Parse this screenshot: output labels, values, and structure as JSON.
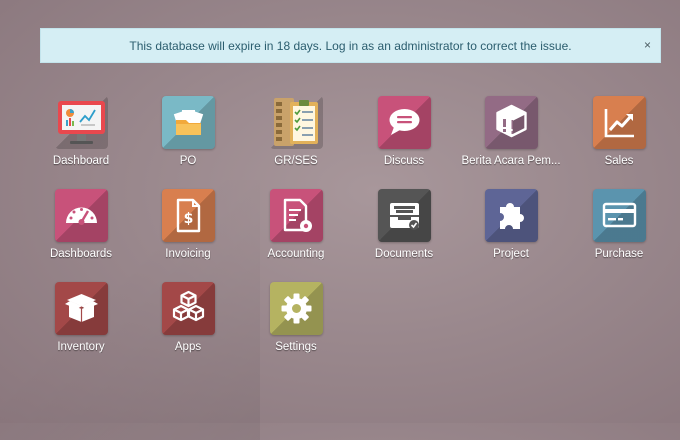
{
  "alert": {
    "message": "This database will expire in 18 days. Log in as an administrator to correct the issue.",
    "close": "×"
  },
  "apps": [
    {
      "label": "Dashboard",
      "icon": "dashboard-monitor-icon",
      "color": "#ffffff"
    },
    {
      "label": "PO",
      "icon": "folder-documents-icon",
      "color": "#7ab9c6"
    },
    {
      "label": "GR/SES",
      "icon": "clipboard-checklist-icon",
      "color": "#ffffff"
    },
    {
      "label": "Discuss",
      "icon": "chat-bubble-icon",
      "color": "#c8527a"
    },
    {
      "label": "Berita Acara Pem...",
      "icon": "box-alert-icon",
      "color": "#936b85"
    },
    {
      "label": "Sales",
      "icon": "chart-trend-icon",
      "color": "#d87f4f"
    },
    {
      "label": "Dashboards",
      "icon": "gauge-icon",
      "color": "#c8527a"
    },
    {
      "label": "Invoicing",
      "icon": "invoice-dollar-icon",
      "color": "#d87f4f"
    },
    {
      "label": "Accounting",
      "icon": "document-gear-icon",
      "color": "#c8527a"
    },
    {
      "label": "Documents",
      "icon": "inbox-tray-icon",
      "color": "#555555"
    },
    {
      "label": "Project",
      "icon": "puzzle-piece-icon",
      "color": "#5e6596"
    },
    {
      "label": "Purchase",
      "icon": "credit-card-icon",
      "color": "#5b94ae"
    },
    {
      "label": "Inventory",
      "icon": "package-box-icon",
      "color": "#a34848"
    },
    {
      "label": "Apps",
      "icon": "cubes-icon",
      "color": "#a34848"
    },
    {
      "label": "Settings",
      "icon": "gear-icon",
      "color": "#b5b361"
    }
  ]
}
